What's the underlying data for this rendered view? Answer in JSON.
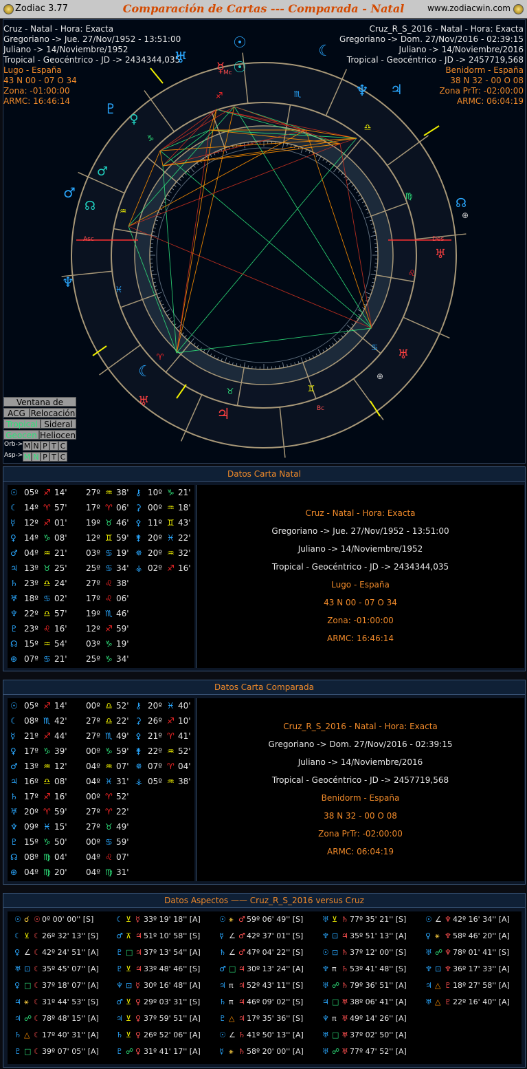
{
  "title": {
    "app": "Zodiac 3.77",
    "main": "Comparación de Cartas --- Comparada - Natal",
    "url": "www.zodiacwin.com"
  },
  "left_info": [
    {
      "t": "Cruz - Natal - Hora: Exacta",
      "c": "w"
    },
    {
      "t": "Gregoriano -> Jue. 27/Nov/1952 - 13:51:00",
      "c": "w"
    },
    {
      "t": "Juliano -> 14/Noviembre/1952",
      "c": "w"
    },
    {
      "t": "Tropical - Geocéntrico - JD -> 2434344,035",
      "c": "w"
    },
    {
      "t": "Lugo - España",
      "c": "o"
    },
    {
      "t": "43 N 00 - 07 O 34",
      "c": "o"
    },
    {
      "t": "Zona: -01:00:00",
      "c": "o"
    },
    {
      "t": "ARMC: 16:46:14",
      "c": "o"
    }
  ],
  "right_info": [
    {
      "t": "Cruz_R_S_2016 - Natal - Hora: Exacta",
      "c": "w"
    },
    {
      "t": "Gregoriano -> Dom. 27/Nov/2016 - 02:39:15",
      "c": "w"
    },
    {
      "t": "Juliano -> 14/Noviembre/2016",
      "c": "w"
    },
    {
      "t": "Tropical - Geocéntrico - JD -> 2457719,568",
      "c": "w"
    },
    {
      "t": "Benidorm - España",
      "c": "o"
    },
    {
      "t": "38 N 32 - 00 O 08",
      "c": "o"
    },
    {
      "t": "Zona PrTr: -02:00:00",
      "c": "o"
    },
    {
      "t": "ARMC: 06:04:19",
      "c": "o"
    }
  ],
  "wheel_labels": {
    "asc": "Asc",
    "des": "Des",
    "mc": "Mc",
    "bc": "Bc"
  },
  "buttons": {
    "ciclos": "Ventana de Ciclos",
    "acg": "ACG",
    "relocacion": "Relocación",
    "tropical": "Tropical",
    "sideral": "Sideral",
    "geocen": "Geocen",
    "heliocen": "Heliocen",
    "orb": "Orb->",
    "asp": "Asp->",
    "letters": [
      "M",
      "N",
      "P",
      "T",
      "C"
    ]
  },
  "natal": {
    "header": "Datos Carta Natal",
    "col1": [
      [
        "☉",
        "05º",
        "♐",
        "14'"
      ],
      [
        "☾",
        "14º",
        "♈",
        "57'"
      ],
      [
        "☿",
        "12º",
        "♐",
        "01'"
      ],
      [
        "♀",
        "14º",
        "♑",
        "08'"
      ],
      [
        "♂",
        "04º",
        "♒",
        "21'"
      ],
      [
        "♃",
        "13º",
        "♉",
        "25'"
      ],
      [
        "♄",
        "23º",
        "♎",
        "24'"
      ],
      [
        "♅",
        "18º",
        "♋",
        "02'"
      ],
      [
        "♆",
        "22º",
        "♎",
        "57'"
      ],
      [
        "♇",
        "23º",
        "♌",
        "16'"
      ],
      [
        "☊",
        "15º",
        "♒",
        "54'"
      ],
      [
        "⊕",
        "07º",
        "♋",
        "21'"
      ]
    ],
    "col2": [
      [
        "27º",
        "♒",
        "38'"
      ],
      [
        "17º",
        "♈",
        "06'"
      ],
      [
        "19º",
        "♉",
        "46'"
      ],
      [
        "12º",
        "♊",
        "59'"
      ],
      [
        "03º",
        "♋",
        "19'"
      ],
      [
        "25º",
        "♋",
        "34'"
      ],
      [
        "27º",
        "♌",
        "38'"
      ],
      [
        "17º",
        "♌",
        "06'"
      ],
      [
        "19º",
        "♏",
        "46'"
      ],
      [
        "12º",
        "♐",
        "59'"
      ],
      [
        "03º",
        "♑",
        "19'"
      ],
      [
        "25º",
        "♑",
        "34'"
      ]
    ],
    "col3": [
      [
        "⚷",
        "10º",
        "♑",
        "21'"
      ],
      [
        "⚳",
        "00º",
        "♒",
        "18'"
      ],
      [
        "⚴",
        "11º",
        "♊",
        "43'"
      ],
      [
        "⚵",
        "20º",
        "♓",
        "22'"
      ],
      [
        "✵",
        "20º",
        "♒",
        "32'"
      ],
      [
        "⚶",
        "02º",
        "♐",
        "16'"
      ]
    ],
    "details": [
      {
        "t": "Cruz - Natal - Hora: Exacta",
        "c": "o"
      },
      {
        "t": "Gregoriano -> Jue. 27/Nov/1952 - 13:51:00",
        "c": "w"
      },
      {
        "t": "Juliano -> 14/Noviembre/1952",
        "c": "w"
      },
      {
        "t": "Tropical - Geocéntrico - JD -> 2434344,035",
        "c": "w"
      },
      {
        "t": "Lugo - España",
        "c": "o"
      },
      {
        "t": "43 N 00 - 07 O 34",
        "c": "o"
      },
      {
        "t": "Zona: -01:00:00",
        "c": "o"
      },
      {
        "t": "ARMC: 16:46:14",
        "c": "o"
      }
    ]
  },
  "comparada": {
    "header": "Datos Carta Comparada",
    "col1": [
      [
        "☉",
        "05º",
        "♐",
        "14'"
      ],
      [
        "☾",
        "08º",
        "♏",
        "42'"
      ],
      [
        "☿",
        "21º",
        "♐",
        "44'"
      ],
      [
        "♀",
        "17º",
        "♑",
        "39'"
      ],
      [
        "♂",
        "13º",
        "♒",
        "12'"
      ],
      [
        "♃",
        "16º",
        "♎",
        "08'"
      ],
      [
        "♄",
        "17º",
        "♐",
        "16'"
      ],
      [
        "♅",
        "20º",
        "♈",
        "59'"
      ],
      [
        "♆",
        "09º",
        "♓",
        "15'"
      ],
      [
        "♇",
        "15º",
        "♑",
        "50'"
      ],
      [
        "☊",
        "08º",
        "♍",
        "04'"
      ],
      [
        "⊕",
        "04º",
        "♍",
        "20'"
      ]
    ],
    "col2": [
      [
        "00º",
        "♎",
        "52'"
      ],
      [
        "27º",
        "♎",
        "22'"
      ],
      [
        "27º",
        "♏",
        "49'"
      ],
      [
        "00º",
        "♑",
        "59'"
      ],
      [
        "04º",
        "♒",
        "07'"
      ],
      [
        "04º",
        "♓",
        "31'"
      ],
      [
        "00º",
        "♈",
        "52'"
      ],
      [
        "27º",
        "♈",
        "22'"
      ],
      [
        "27º",
        "♉",
        "49'"
      ],
      [
        "00º",
        "♋",
        "59'"
      ],
      [
        "04º",
        "♌",
        "07'"
      ],
      [
        "04º",
        "♍",
        "31'"
      ]
    ],
    "col3": [
      [
        "⚷",
        "20º",
        "♓",
        "40'"
      ],
      [
        "⚳",
        "26º",
        "♐",
        "10'"
      ],
      [
        "⚴",
        "21º",
        "♈",
        "41'"
      ],
      [
        "⚵",
        "22º",
        "♒",
        "52'"
      ],
      [
        "✵",
        "07º",
        "♈",
        "04'"
      ],
      [
        "⚶",
        "05º",
        "♒",
        "38'"
      ]
    ],
    "details": [
      {
        "t": "Cruz_R_S_2016 - Natal - Hora: Exacta",
        "c": "o"
      },
      {
        "t": "Gregoriano -> Dom. 27/Nov/2016 - 02:39:15",
        "c": "w"
      },
      {
        "t": "Juliano -> 14/Noviembre/2016",
        "c": "w"
      },
      {
        "t": "Tropical - Geocéntrico - JD -> 2457719,568",
        "c": "w"
      },
      {
        "t": "Benidorm - España",
        "c": "o"
      },
      {
        "t": "38 N 32 - 00 O 08",
        "c": "o"
      },
      {
        "t": "Zona PrTr: -02:00:00",
        "c": "o"
      },
      {
        "t": "ARMC: 06:04:19",
        "c": "o"
      }
    ]
  },
  "aspects": {
    "header": "Datos Aspectos   ——   Cruz_R_S_2016   versus   Cruz",
    "rows": [
      [
        [
          "☉",
          "☌",
          "☉",
          "0º 00' 00'' [S]"
        ],
        [
          "☾",
          "⊻",
          "☿",
          "33º 19' 18'' [A]"
        ],
        [
          "☉",
          "⚹",
          "♂",
          "59º 06' 49'' [S]"
        ],
        [
          "♅",
          "⊻",
          "♄",
          "77º 35' 21'' [S]"
        ],
        [
          "☉",
          "∠",
          "♆",
          "42º 16' 34'' [A]"
        ]
      ],
      [
        [
          "☾",
          "⊻",
          "☾",
          "26º 32' 13'' [S]"
        ],
        [
          "♂",
          "⊼",
          "♃",
          "51º 10' 58'' [S]"
        ],
        [
          "☿",
          "∠",
          "♂",
          "42º 37' 01'' [S]"
        ],
        [
          "♆",
          "⊡",
          "♃",
          "35º 51' 13'' [A]"
        ],
        [
          "♀",
          "⚹",
          "♆",
          "58º 46' 20'' [A]"
        ]
      ],
      [
        [
          "♀",
          "∠",
          "☾",
          "42º 24' 51'' [A]"
        ],
        [
          "♇",
          "□",
          "♃",
          "37º 13' 54'' [A]"
        ],
        [
          "♄",
          "∠",
          "♂",
          "47º 04' 22'' [S]"
        ],
        [
          "☉",
          "⊡",
          "♄",
          "37º 12' 00'' [S]"
        ],
        [
          "♅",
          "☍",
          "♆",
          "78º 01' 41'' [S]"
        ]
      ],
      [
        [
          "♅",
          "⊡",
          "☾",
          "35º 45' 07'' [A]"
        ],
        [
          "♇",
          "⊻",
          "♃",
          "33º 48' 46'' [S]"
        ],
        [
          "♂",
          "□",
          "♃",
          "30º 13' 24'' [A]"
        ],
        [
          "♆",
          "π",
          "♄",
          "53º 41' 48'' [S]"
        ],
        [
          "♆",
          "⊡",
          "♆",
          "36º 17' 33'' [A]"
        ]
      ],
      [
        [
          "♀",
          "□",
          "☾",
          "37º 18' 07'' [A]"
        ],
        [
          "♆",
          "⊡",
          "☿",
          "30º 16' 48'' [A]"
        ],
        [
          "♃",
          "π",
          "♃",
          "52º 43' 11'' [S]"
        ],
        [
          "♅",
          "☍",
          "♄",
          "79º 36' 51'' [A]"
        ],
        [
          "♃",
          "△",
          "♇",
          "18º 27' 58'' [A]"
        ]
      ],
      [
        [
          "♃",
          "⚹",
          "☾",
          "31º 44' 53'' [S]"
        ],
        [
          "♂",
          "⊻",
          "♀",
          "29º 03' 31'' [S]"
        ],
        [
          "♄",
          "π",
          "♃",
          "46º 09' 02'' [S]"
        ],
        [
          "♃",
          "□",
          "♅",
          "38º 06' 41'' [A]"
        ],
        [
          "♅",
          "△",
          "♇",
          "22º 16' 40'' [A]"
        ]
      ],
      [
        [
          "♃",
          "☍",
          "☾",
          "78º 48' 15'' [A]"
        ],
        [
          "♃",
          "⊻",
          "♀",
          "37º 59' 51'' [A]"
        ],
        [
          "♇",
          "△",
          "♃",
          "17º 35' 36'' [S]"
        ],
        [
          "♆",
          "π",
          "♅",
          "49º 14' 26'' [A]"
        ]
      ],
      [
        [
          "♄",
          "△",
          "☾",
          "17º 40' 31'' [A]"
        ],
        [
          "♄",
          "⊻",
          "♀",
          "26º 52' 06'' [A]"
        ],
        [
          "☉",
          "∠",
          "♄",
          "41º 50' 13'' [A]"
        ],
        [
          "♅",
          "□",
          "♅",
          "37º 02' 50'' [A]"
        ]
      ],
      [
        [
          "♇",
          "□",
          "☾",
          "39º 07' 05'' [A]"
        ],
        [
          "♇",
          "☍",
          "♀",
          "31º 41' 17'' [A]"
        ],
        [
          "☿",
          "⚹",
          "♄",
          "58º 20' 00'' [A]"
        ],
        [
          "♅",
          "☍",
          "♅",
          "77º 47' 52'' [A]"
        ]
      ]
    ]
  },
  "colors": {
    "fire": "#ff2828",
    "earth": "#2ee07a",
    "air": "#f0f000",
    "water": "#2aa8ff",
    "planet_in": "#2aa8ff",
    "planet_out": "#ff4040",
    "accent": "#f08a2a"
  }
}
